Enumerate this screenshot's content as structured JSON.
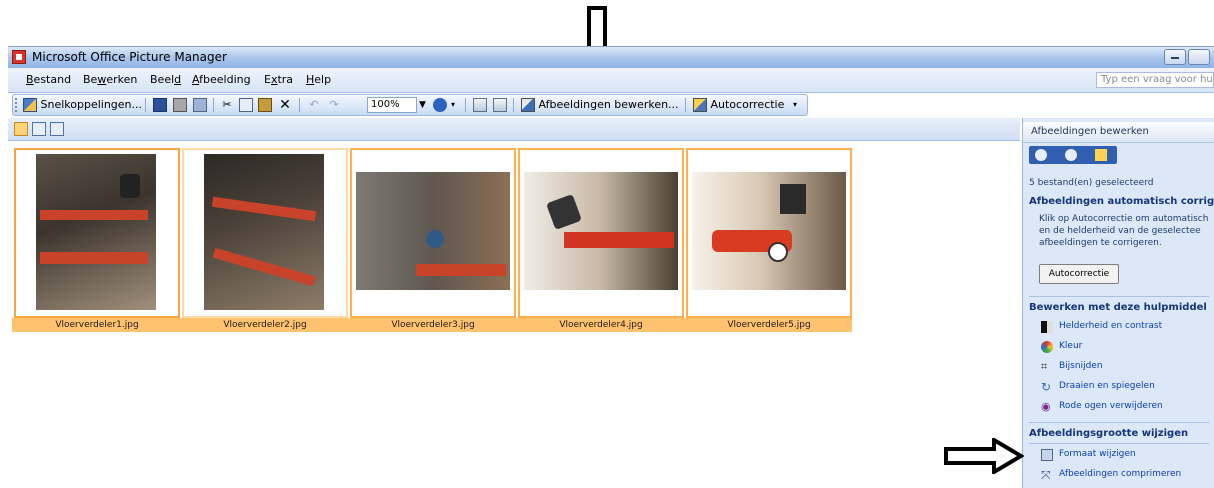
{
  "window": {
    "title": "Microsoft Office Picture Manager"
  },
  "menu": {
    "items": [
      {
        "pre": "",
        "u": "B",
        "post": "estand"
      },
      {
        "pre": "Be",
        "u": "w",
        "post": "erken"
      },
      {
        "pre": "Beel",
        "u": "d",
        "post": ""
      },
      {
        "pre": "",
        "u": "A",
        "post": "fbeelding"
      },
      {
        "pre": "E",
        "u": "x",
        "post": "tra"
      },
      {
        "pre": "",
        "u": "H",
        "post": "elp"
      }
    ],
    "help_placeholder": "Typ een vraag voor hu"
  },
  "toolbar": {
    "shortcuts": "Snelkoppelingen...",
    "zoom": "100%",
    "edit_pictures": "Afbeeldingen bewerken...",
    "autocorrect": "Autocorrectie"
  },
  "thumbnails": [
    {
      "caption": "Vloerverdeler1.jpg"
    },
    {
      "caption": "Vloerverdeler2.jpg"
    },
    {
      "caption": "Vloerverdeler3.jpg"
    },
    {
      "caption": "Vloerverdeler4.jpg"
    },
    {
      "caption": "Vloerverdeler5.jpg"
    }
  ],
  "pane": {
    "title": "Afbeeldingen bewerken",
    "selected": "5 bestand(en) geselecteerd",
    "auto_title": "Afbeeldingen automatisch corrig",
    "auto_desc": [
      "Klik op Autocorrectie om automatisch",
      "en de helderheid van de geselectee",
      "afbeeldingen te corrigeren."
    ],
    "auto_button": "Autocorrectie",
    "tools_title": "Bewerken met deze hulpmiddel",
    "tools": [
      {
        "label": "Helderheid en contrast",
        "icon": "brightness-icon"
      },
      {
        "label": "Kleur",
        "icon": "color-icon"
      },
      {
        "label": "Bijsnijden",
        "icon": "crop-icon"
      },
      {
        "label": "Draaien en spiegelen",
        "icon": "rotate-icon"
      },
      {
        "label": "Rode ogen verwijderen",
        "icon": "red-eye-icon"
      }
    ],
    "size_title": "Afbeeldingsgrootte wijzigen",
    "size_tools": [
      {
        "label": "Formaat wijzigen",
        "icon": "resize-icon"
      },
      {
        "label": "Afbeeldingen comprimeren",
        "icon": "compress-icon"
      }
    ]
  },
  "colors": {
    "selection": "#ffb04c",
    "pane_bg": "#dce8f8",
    "titlebar": "#a9c5ec"
  }
}
